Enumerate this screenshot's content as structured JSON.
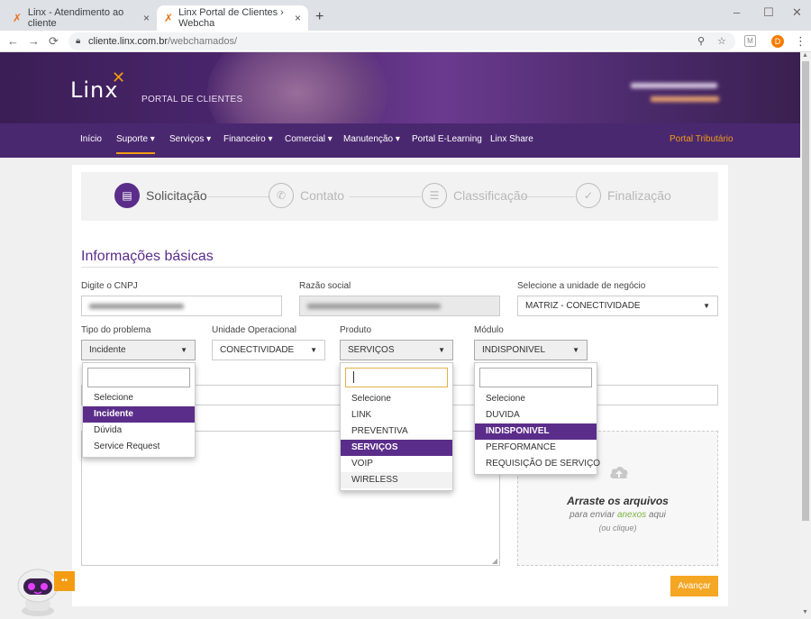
{
  "browser": {
    "tabs": [
      {
        "title": "Linx - Atendimento ao cliente",
        "close": "×"
      },
      {
        "title": "Linx Portal de Clientes › Webcha",
        "close": "×"
      }
    ],
    "new_tab": "+",
    "window": {
      "minimize": "–",
      "maximize": "☐",
      "close": "✕"
    },
    "nav": {
      "back": "←",
      "forward": "→",
      "reload": "⟳"
    },
    "url_host": "cliente.linx.com.br",
    "url_path": "/webchamados/",
    "zoom_icon": "⚲",
    "star_icon": "☆",
    "ext_label": "M",
    "profile_initial": "D",
    "menu_icon": "⋮"
  },
  "header": {
    "logo": "Linx",
    "logo_mark": "✕",
    "subtitle": "PORTAL DE CLIENTES"
  },
  "navbar": {
    "items": [
      "Início",
      "Suporte ▾",
      "Serviços ▾",
      "Financeiro ▾",
      "Comercial ▾",
      "Manutenção ▾",
      "Portal E-Learning",
      "Linx Share"
    ],
    "right_link": "Portal Tributário"
  },
  "steps": [
    {
      "label": "Solicitação",
      "icon": "▤"
    },
    {
      "label": "Contato",
      "icon": "✆"
    },
    {
      "label": "Classificação",
      "icon": "☰"
    },
    {
      "label": "Finalização",
      "icon": "✓"
    }
  ],
  "form": {
    "section_title": "Informações básicas",
    "cnpj_label": "Digite o CNPJ",
    "razao_label": "Razão social",
    "unidade_negocio_label": "Selecione a unidade de negócio",
    "unidade_negocio_value": "MATRIZ - CONECTIVIDADE",
    "tipo_label": "Tipo do problema",
    "tipo_value": "Incidente",
    "unidade_op_label": "Unidade Operacional",
    "unidade_op_value": "CONECTIVIDADE",
    "produto_label": "Produto",
    "produto_value": "SERVIÇOS",
    "modulo_label": "Módulo",
    "modulo_value": "INDISPONIVEL"
  },
  "dropdowns": {
    "tipo_options": [
      "Selecione",
      "Incidente",
      "Dúvida",
      "Service Request"
    ],
    "produto_options": [
      "Selecione",
      "LINK",
      "PREVENTIVA",
      "SERVIÇOS",
      "VOIP",
      "WIRELESS"
    ],
    "modulo_options": [
      "Selecione",
      "DUVIDA",
      "INDISPONIVEL",
      "PERFORMANCE",
      "REQUISIÇÃO DE SERVIÇO"
    ]
  },
  "dropzone": {
    "title": "Arraste os arquivos",
    "sub_before": "para enviar ",
    "sub_link": "anexos",
    "sub_after": " aqui",
    "or_click": "(ou clique)"
  },
  "actions": {
    "next_label": "Avançar"
  },
  "chat": {
    "badge": "••"
  },
  "colors": {
    "brand_purple": "#5b2d8a",
    "accent_orange": "#f39c12",
    "nav_bg": "#4a2870"
  }
}
